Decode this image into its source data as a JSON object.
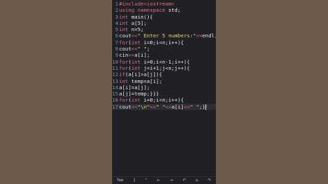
{
  "editor": {
    "lines": [
      {
        "num": "1",
        "segments": [
          {
            "t": "#include<iostream>",
            "c": "kw"
          }
        ]
      },
      {
        "num": "2",
        "segments": [
          {
            "t": "using namespace",
            "c": "kw"
          },
          {
            "t": " std;",
            "c": "code"
          }
        ]
      },
      {
        "num": "3",
        "segments": [
          {
            "t": "int",
            "c": "kw"
          },
          {
            "t": " main(){",
            "c": "code"
          }
        ]
      },
      {
        "num": "4",
        "segments": [
          {
            "t": "int",
            "c": "kw"
          },
          {
            "t": " a[5];",
            "c": "code"
          }
        ]
      },
      {
        "num": "5",
        "segments": [
          {
            "t": "int",
            "c": "kw"
          },
          {
            "t": " n=5;",
            "c": "code"
          }
        ]
      },
      {
        "num": "6",
        "segments": [
          {
            "t": "cout",
            "c": "code"
          },
          {
            "t": "<<",
            "c": "op"
          },
          {
            "t": "\" Enter 5 numbers:\"",
            "c": "str"
          },
          {
            "t": "<<",
            "c": "op"
          },
          {
            "t": "endl;",
            "c": "code"
          }
        ]
      },
      {
        "num": "7",
        "segments": [
          {
            "t": "for",
            "c": "kw"
          },
          {
            "t": "(",
            "c": "code"
          },
          {
            "t": "int",
            "c": "kw"
          },
          {
            "t": " i=0;i<n;i++){",
            "c": "code"
          }
        ]
      },
      {
        "num": "8",
        "segments": [
          {
            "t": "cout",
            "c": "code"
          },
          {
            "t": "<<",
            "c": "op"
          },
          {
            "t": "\" \"",
            "c": "str"
          },
          {
            "t": ";",
            "c": "code"
          }
        ]
      },
      {
        "num": "9",
        "segments": [
          {
            "t": "cin",
            "c": "code"
          },
          {
            "t": ">>",
            "c": "op"
          },
          {
            "t": "a[i];",
            "c": "code"
          }
        ]
      },
      {
        "num": "10",
        "segments": [
          {
            "t": "for",
            "c": "kw"
          },
          {
            "t": "(",
            "c": "code"
          },
          {
            "t": "int",
            "c": "kw"
          },
          {
            "t": " i=0;i<n-1;i++){",
            "c": "code"
          }
        ]
      },
      {
        "num": "11",
        "segments": [
          {
            "t": "for",
            "c": "kw"
          },
          {
            "t": "(",
            "c": "code"
          },
          {
            "t": "int",
            "c": "kw"
          },
          {
            "t": " j=i+1;j<n;j++){",
            "c": "code"
          }
        ]
      },
      {
        "num": "12",
        "segments": [
          {
            "t": "if",
            "c": "kw"
          },
          {
            "t": "(a[i]>a[j]){",
            "c": "code"
          }
        ]
      },
      {
        "num": "13",
        "segments": [
          {
            "t": "int",
            "c": "kw"
          },
          {
            "t": " temp=a[i];",
            "c": "code"
          }
        ]
      },
      {
        "num": "14",
        "segments": [
          {
            "t": "a[i]=a[j];",
            "c": "code"
          }
        ]
      },
      {
        "num": "15",
        "segments": [
          {
            "t": "a[j]=temp;}}}",
            "c": "code"
          }
        ]
      },
      {
        "num": "16",
        "segments": [
          {
            "t": "for",
            "c": "kw"
          },
          {
            "t": "(",
            "c": "code"
          },
          {
            "t": "int",
            "c": "kw"
          },
          {
            "t": " i=0;i<n;i++){",
            "c": "code"
          }
        ]
      },
      {
        "num": "17",
        "segments": [
          {
            "t": "cout",
            "c": "code"
          },
          {
            "t": "<<",
            "c": "op"
          },
          {
            "t": "\"\\n\"",
            "c": "str"
          },
          {
            "t": "<<",
            "c": "op"
          },
          {
            "t": "\" \"",
            "c": "str"
          },
          {
            "t": "<<",
            "c": "op"
          },
          {
            "t": "a[i]",
            "c": "code"
          },
          {
            "t": "<<",
            "c": "op"
          },
          {
            "t": "\" \"",
            "c": "str"
          },
          {
            "t": ";}",
            "c": "code"
          }
        ],
        "current": true
      }
    ]
  },
  "keybar": {
    "keys": [
      {
        "label": "Tab",
        "name": "tab-key"
      },
      {
        "label": "{",
        "name": "open-brace-key"
      },
      {
        "label": "\"",
        "name": "double-quote-key"
      },
      {
        "label": "←",
        "name": "arrow-left-key"
      },
      {
        "label": "→",
        "name": "arrow-right-key"
      },
      {
        "label": "↶",
        "name": "undo-key"
      },
      {
        "label": "⌂",
        "name": "home-key"
      },
      {
        "label": "↷",
        "name": "redo-key"
      }
    ]
  },
  "colors": {
    "background": "#6f5b4c",
    "editor_bg": "#202124",
    "keyword": "#e06c88",
    "string": "#e9d36d",
    "text": "#e8e8e8"
  }
}
